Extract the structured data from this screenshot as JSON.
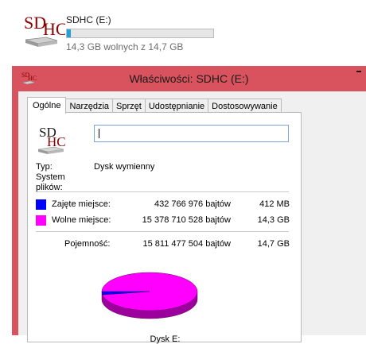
{
  "drive": {
    "icon_text_line1": "SD",
    "icon_text_line2": "HC",
    "name": "SDHC (E:)",
    "free_text": "14,3 GB wolnych z 14,7 GB",
    "used_fraction": 0.027
  },
  "dialog": {
    "title": "Właściwości: SDHC (E:)",
    "tabs": [
      "Ogólne",
      "Narzędzia",
      "Sprzęt",
      "Udostępnianie",
      "Dostosowywanie"
    ],
    "active_tab": "Ogólne",
    "icon_text_line1": "SD",
    "icon_text_line2": "HC",
    "name_value": "",
    "type_label": "Typ:",
    "type_value": "Dysk wymienny",
    "fs_label": "System plików:",
    "used": {
      "label": "Zajęte miejsce:",
      "bytes": "432 766 976 bajtów",
      "size": "412 MB",
      "color": "#0000ff"
    },
    "free": {
      "label": "Wolne miejsce:",
      "bytes": "15 378 710 528 bajtów",
      "size": "14,3 GB",
      "color": "#ff00ff"
    },
    "capacity": {
      "label": "Pojemność:",
      "bytes": "15 811 477 504 bajtów",
      "size": "14,7 GB"
    },
    "disk_label": "Dysk E:"
  }
}
